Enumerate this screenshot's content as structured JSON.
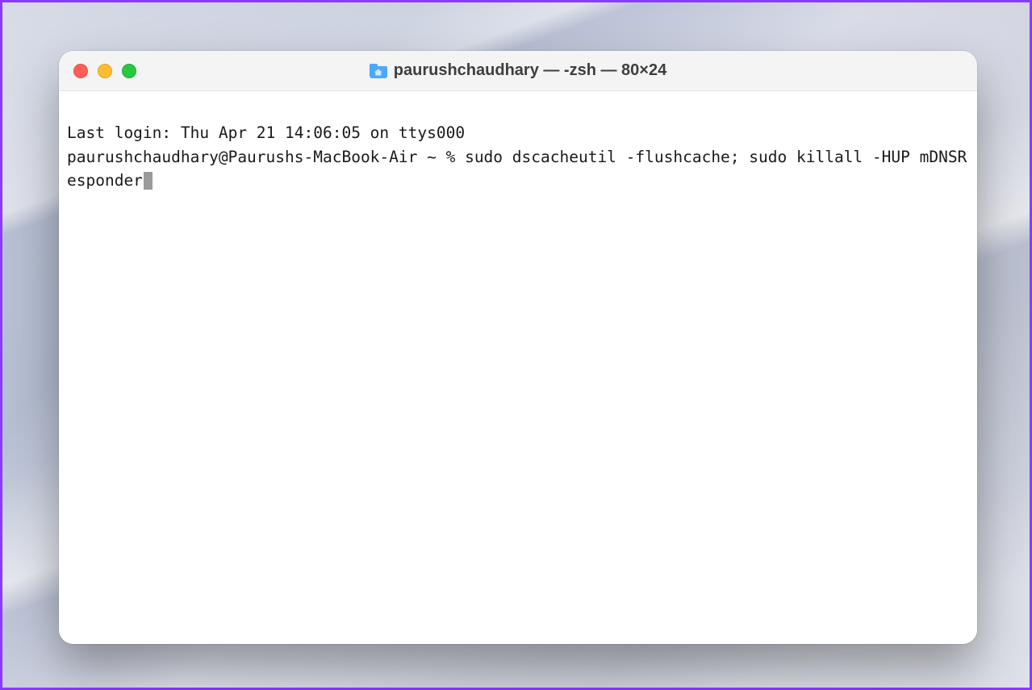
{
  "titlebar": {
    "title": "paurushchaudhary — -zsh — 80×24"
  },
  "terminal": {
    "last_login_line": "Last login: Thu Apr 21 14:06:05 on ttys000",
    "prompt_and_command": "paurushchaudhary@Paurushs-MacBook-Air ~ % sudo dscacheutil -flushcache; sudo killall -HUP mDNSResponder"
  }
}
